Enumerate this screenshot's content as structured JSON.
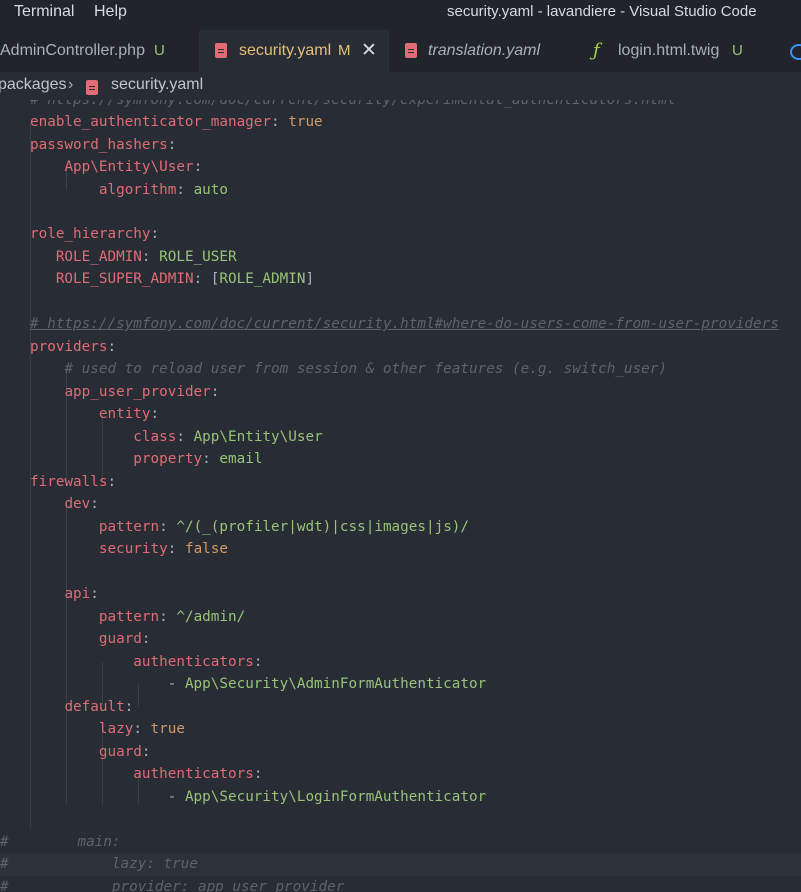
{
  "menu": [
    "Terminal",
    "Help"
  ],
  "window_title": "security.yaml - lavandiere - Visual Studio Code",
  "tabs": [
    {
      "label": "AdminController.php",
      "status": "U"
    },
    {
      "label": "security.yaml",
      "status": "M",
      "close": "✕"
    },
    {
      "label": "translation.yaml"
    },
    {
      "label": "login.html.twig",
      "status": "U"
    }
  ],
  "breadcrumb": {
    "parent": "packages",
    "file": "security.yaml"
  },
  "code": {
    "l0": "# https://symfony.com/doc/current/security/experimental_authenticators.html",
    "l1k": "enable_authenticator_manager",
    "l1v": "true",
    "l2k": "password_hashers",
    "l3k": "App\\Entity\\User",
    "l4k": "algorithm",
    "l4v": "auto",
    "l6k": "role_hierarchy",
    "l7k": "ROLE_ADMIN",
    "l7v": "ROLE_USER",
    "l8k": "ROLE_SUPER_ADMIN",
    "l8v": "ROLE_ADMIN",
    "l10": "# https://symfony.com/doc/current/security.html#where-do-users-come-from-user-providers",
    "l11k": "providers",
    "l12": "# used to reload user from session & other features (e.g. switch_user)",
    "l13k": "app_user_provider",
    "l14k": "entity",
    "l15k": "class",
    "l15v": "App\\Entity\\User",
    "l16k": "property",
    "l16v": "email",
    "l17k": "firewalls",
    "l18k": "dev",
    "l19k": "pattern",
    "l19v": "^/(_(profiler|wdt)|css|images|js)/",
    "l20k": "security",
    "l20v": "false",
    "l22k": "api",
    "l23k": "pattern",
    "l23v": "^/admin/",
    "l24k": "guard",
    "l25k": "authenticators",
    "l26v": "App\\Security\\AdminFormAuthenticator",
    "l27k": "default",
    "l28k": "lazy",
    "l28v": "true",
    "l29k": "guard",
    "l30k": "authenticators",
    "l31v": "App\\Security\\LoginFormAuthenticator",
    "l33": "#        main:",
    "l34": "#            lazy: true",
    "l35": "#            provider: app_user_provider"
  },
  "colors": {
    "keyword": "#e06c75",
    "string": "#98c379",
    "comment": "#5c6370",
    "modified": "#e5c07b",
    "background": "#282c34"
  }
}
